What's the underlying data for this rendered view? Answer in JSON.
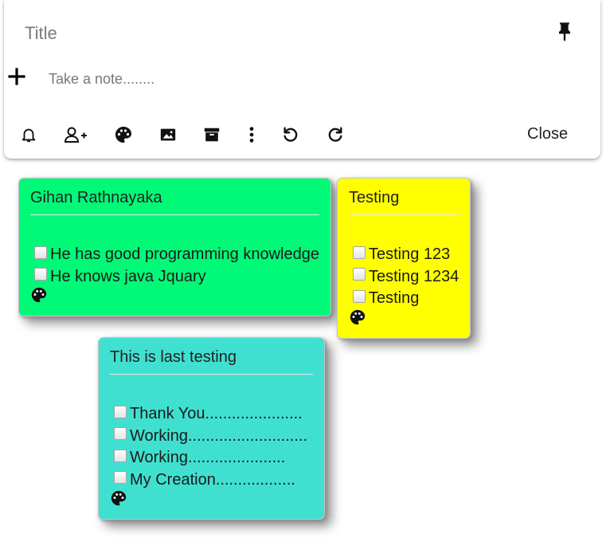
{
  "editor": {
    "title_placeholder": "Title",
    "note_placeholder": "Take a note........",
    "close_label": "Close",
    "pin_icon": "pin-icon",
    "add_icon": "plus-icon",
    "toolbar": [
      {
        "name": "bell-icon"
      },
      {
        "name": "add-person-icon"
      },
      {
        "name": "palette-icon"
      },
      {
        "name": "image-icon"
      },
      {
        "name": "archive-icon"
      },
      {
        "name": "more-vert-icon"
      },
      {
        "name": "undo-icon"
      },
      {
        "name": "redo-icon"
      }
    ]
  },
  "notes": [
    {
      "title": "Gihan Rathnayaka",
      "color": "#00fa78",
      "items": [
        "He has good programming knowledge",
        "He knows java Jquary"
      ]
    },
    {
      "title": "Testing",
      "color": "#ffff00",
      "items": [
        "Testing 123",
        "Testing 1234",
        "Testing"
      ]
    },
    {
      "title": "This is last testing",
      "color": "#40e0d0",
      "items": [
        "Thank You......................",
        "Working...........................",
        "Working......................",
        "My Creation.................."
      ]
    }
  ]
}
